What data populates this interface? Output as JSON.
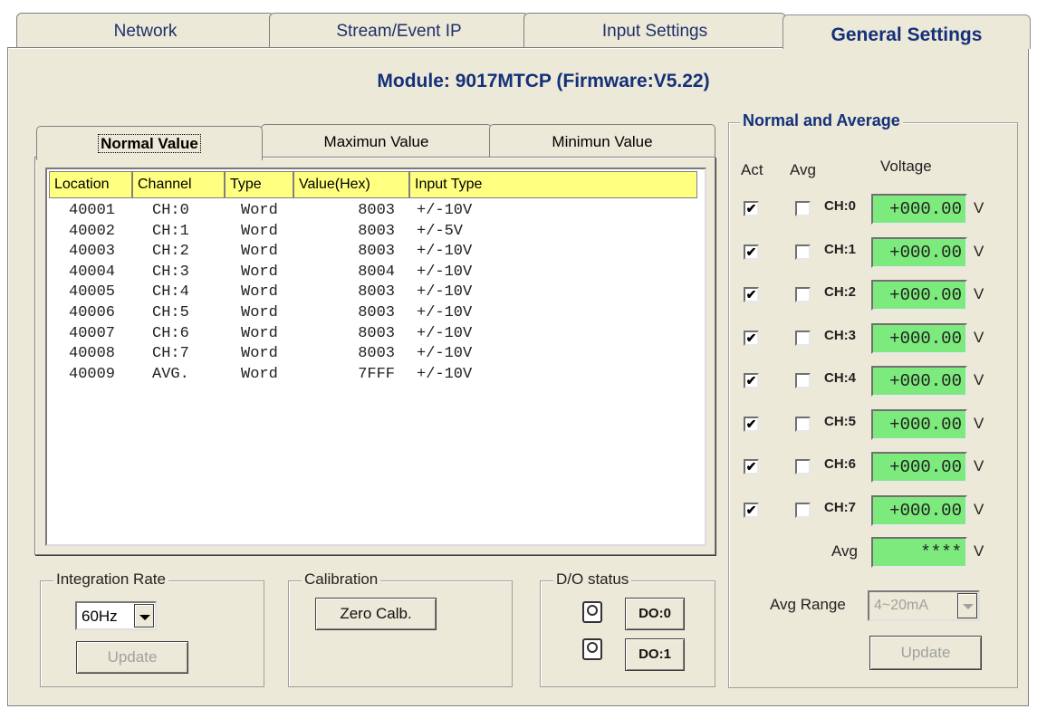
{
  "tabs": [
    "Network",
    "Stream/Event IP",
    "Input Settings",
    "General Settings"
  ],
  "module_title": "Module: 9017MTCP (Firmware:V5.22)",
  "subtabs": [
    "Normal Value",
    "Maximun Value",
    "Minimun Value"
  ],
  "table": {
    "headers": [
      "Location",
      "Channel",
      "Type",
      "Value(Hex)",
      "Input Type"
    ],
    "rows": [
      [
        "40001",
        "CH:0",
        "Word",
        "8003",
        "+/-10V"
      ],
      [
        "40002",
        "CH:1",
        "Word",
        "8003",
        "+/-5V"
      ],
      [
        "40003",
        "CH:2",
        "Word",
        "8003",
        "+/-10V"
      ],
      [
        "40004",
        "CH:3",
        "Word",
        "8004",
        "+/-10V"
      ],
      [
        "40005",
        "CH:4",
        "Word",
        "8003",
        "+/-10V"
      ],
      [
        "40006",
        "CH:5",
        "Word",
        "8003",
        "+/-10V"
      ],
      [
        "40007",
        "CH:6",
        "Word",
        "8003",
        "+/-10V"
      ],
      [
        "40008",
        "CH:7",
        "Word",
        "8003",
        "+/-10V"
      ],
      [
        "40009",
        "AVG.",
        "Word",
        "7FFF",
        "+/-10V"
      ]
    ]
  },
  "integration": {
    "label": "Integration Rate",
    "value": "60Hz",
    "update_label": "Update"
  },
  "calibration": {
    "label": "Calibration",
    "button_label": "Zero Calb."
  },
  "do_status": {
    "label": "D/O status",
    "buttons": [
      "DO:0",
      "DO:1"
    ]
  },
  "normal_avg": {
    "label": "Normal and Average",
    "col_act": "Act",
    "col_avg": "Avg",
    "col_voltage": "Voltage",
    "channels": [
      {
        "name": "CH:0",
        "value": "+000.00",
        "act": true,
        "avg": false
      },
      {
        "name": "CH:1",
        "value": "+000.00",
        "act": true,
        "avg": false
      },
      {
        "name": "CH:2",
        "value": "+000.00",
        "act": true,
        "avg": false
      },
      {
        "name": "CH:3",
        "value": "+000.00",
        "act": true,
        "avg": false
      },
      {
        "name": "CH:4",
        "value": "+000.00",
        "act": true,
        "avg": false
      },
      {
        "name": "CH:5",
        "value": "+000.00",
        "act": true,
        "avg": false
      },
      {
        "name": "CH:6",
        "value": "+000.00",
        "act": true,
        "avg": false
      },
      {
        "name": "CH:7",
        "value": "+000.00",
        "act": true,
        "avg": false
      }
    ],
    "unit": "V",
    "avg_label": "Avg",
    "avg_value": "****",
    "avg_range_label": "Avg Range",
    "avg_range_value": "4~20mA",
    "update_label": "Update"
  },
  "colors": {
    "value_bg": "#7dea7d",
    "header_bg": "#ffff80",
    "title": "#14307a"
  },
  "icons": {
    "check": "check-mark-icon",
    "do": "lamp-icon"
  }
}
